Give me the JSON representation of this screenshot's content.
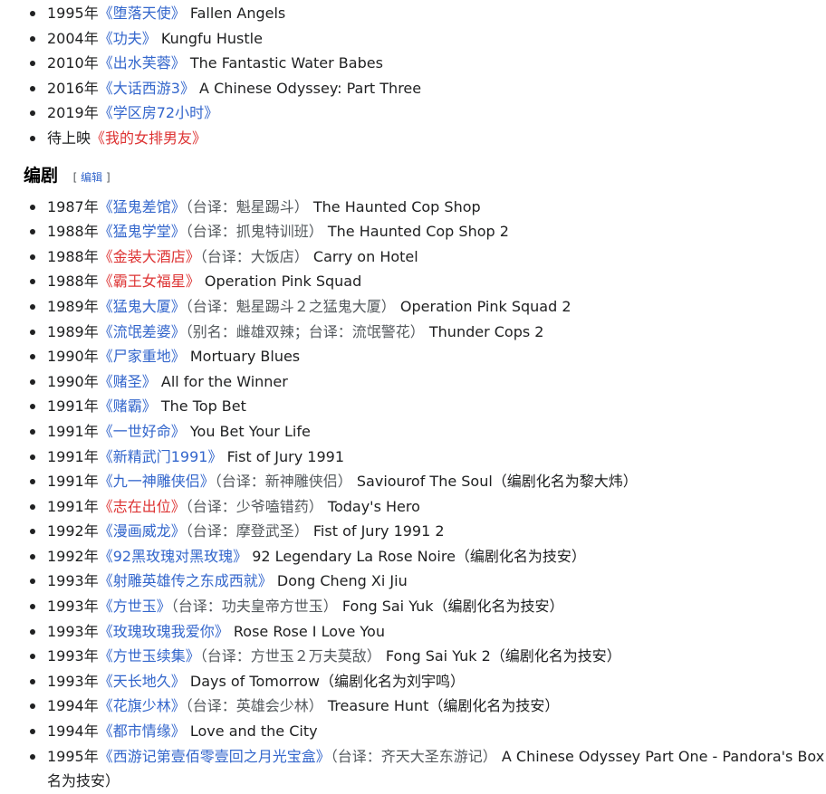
{
  "top_items": [
    {
      "year": "1995年",
      "title": "堕落天使",
      "red": false,
      "note": "",
      "english": "Fallen Angels"
    },
    {
      "year": "2004年",
      "title": "功夫",
      "red": false,
      "note": "",
      "english": "Kungfu Hustle"
    },
    {
      "year": "2010年",
      "title": "出水芙蓉",
      "red": false,
      "note": "",
      "english": "The Fantastic Water Babes"
    },
    {
      "year": "2016年",
      "title": "大话西游3",
      "red": false,
      "note": "",
      "english": "A Chinese Odyssey: Part Three"
    },
    {
      "year": "2019年",
      "title": "学区房72小时",
      "red": false,
      "note": "",
      "english": ""
    },
    {
      "year": "待上映",
      "title": "我的女排男友",
      "red": true,
      "note": "",
      "english": ""
    }
  ],
  "section": {
    "title": "编剧",
    "edit_label": "编辑"
  },
  "screenwriter_items": [
    {
      "year": "1987年",
      "title": "猛鬼差馆",
      "red": false,
      "note": "（台译：魁星踢斗）",
      "english": "The Haunted Cop Shop"
    },
    {
      "year": "1988年",
      "title": "猛鬼学堂",
      "red": false,
      "note": "（台译：抓鬼特训班）",
      "english": "The Haunted Cop Shop 2"
    },
    {
      "year": "1988年",
      "title": "金装大酒店",
      "red": true,
      "note": "（台译：大饭店）",
      "english": "Carry on Hotel"
    },
    {
      "year": "1988年",
      "title": "霸王女福星",
      "red": true,
      "note": "",
      "english": "Operation Pink Squad"
    },
    {
      "year": "1989年",
      "title": "猛鬼大厦",
      "red": false,
      "note": "（台译：魁星踢斗２之猛鬼大厦）",
      "english": "Operation Pink Squad 2"
    },
    {
      "year": "1989年",
      "title": "流氓差婆",
      "red": false,
      "note": "（别名：雌雄双辣；台译：流氓警花）",
      "english": "Thunder Cops 2"
    },
    {
      "year": "1990年",
      "title": "尸家重地",
      "red": false,
      "note": "",
      "english": "Mortuary Blues"
    },
    {
      "year": "1990年",
      "title": "赌圣",
      "red": false,
      "note": "",
      "english": "All for the Winner"
    },
    {
      "year": "1991年",
      "title": "赌霸",
      "red": false,
      "note": "",
      "english": "The Top Bet"
    },
    {
      "year": "1991年",
      "title": "一世好命",
      "red": false,
      "note": "",
      "english": "You Bet Your Life"
    },
    {
      "year": "1991年",
      "title": "新精武门1991",
      "red": false,
      "note": "",
      "english": "Fist of Jury 1991"
    },
    {
      "year": "1991年",
      "title": "九一神雕侠侣",
      "red": false,
      "note": "（台译：新神雕侠侣）",
      "english": "Saviourof The Soul（编剧化名为黎大炜）"
    },
    {
      "year": "1991年",
      "title": "志在出位",
      "red": true,
      "note": "（台译：少爷嗑错药）",
      "english": "Today's Hero"
    },
    {
      "year": "1992年",
      "title": "漫画威龙",
      "red": false,
      "note": "（台译：摩登武圣）",
      "english": "Fist of Jury 1991 2"
    },
    {
      "year": "1992年",
      "title": "92黑玫瑰对黑玫瑰",
      "red": false,
      "note": "",
      "english": "92 Legendary La Rose Noire（编剧化名为技安）"
    },
    {
      "year": "1993年",
      "title": "射雕英雄传之东成西就",
      "red": false,
      "note": "",
      "english": "Dong Cheng Xi Jiu"
    },
    {
      "year": "1993年",
      "title": "方世玉",
      "red": false,
      "note": "（台译：功夫皇帝方世玉）",
      "english": "Fong Sai Yuk（编剧化名为技安）"
    },
    {
      "year": "1993年",
      "title": "玫瑰玫瑰我爱你",
      "red": false,
      "note": "",
      "english": "Rose Rose I Love You"
    },
    {
      "year": "1993年",
      "title": "方世玉续集",
      "red": false,
      "note": "（台译：方世玉２万夫莫敌）",
      "english": "Fong Sai Yuk 2（编剧化名为技安）"
    },
    {
      "year": "1993年",
      "title": "天长地久",
      "red": false,
      "note": "",
      "english": "Days of Tomorrow（编剧化名为刘宇鸣）"
    },
    {
      "year": "1994年",
      "title": "花旗少林",
      "red": false,
      "note": "（台译：英雄会少林）",
      "english": "Treasure Hunt（编剧化名为技安）"
    },
    {
      "year": "1994年",
      "title": "都市情缘",
      "red": false,
      "note": "",
      "english": "Love and the City"
    },
    {
      "year": "1995年",
      "title": "西游记第壹佰零壹回之月光宝盒",
      "red": false,
      "note": "（台译：齐天大圣东游记）",
      "english": "A Chinese Odyssey Part One - Pandora's Box",
      "continuation": "名为技安）"
    }
  ]
}
